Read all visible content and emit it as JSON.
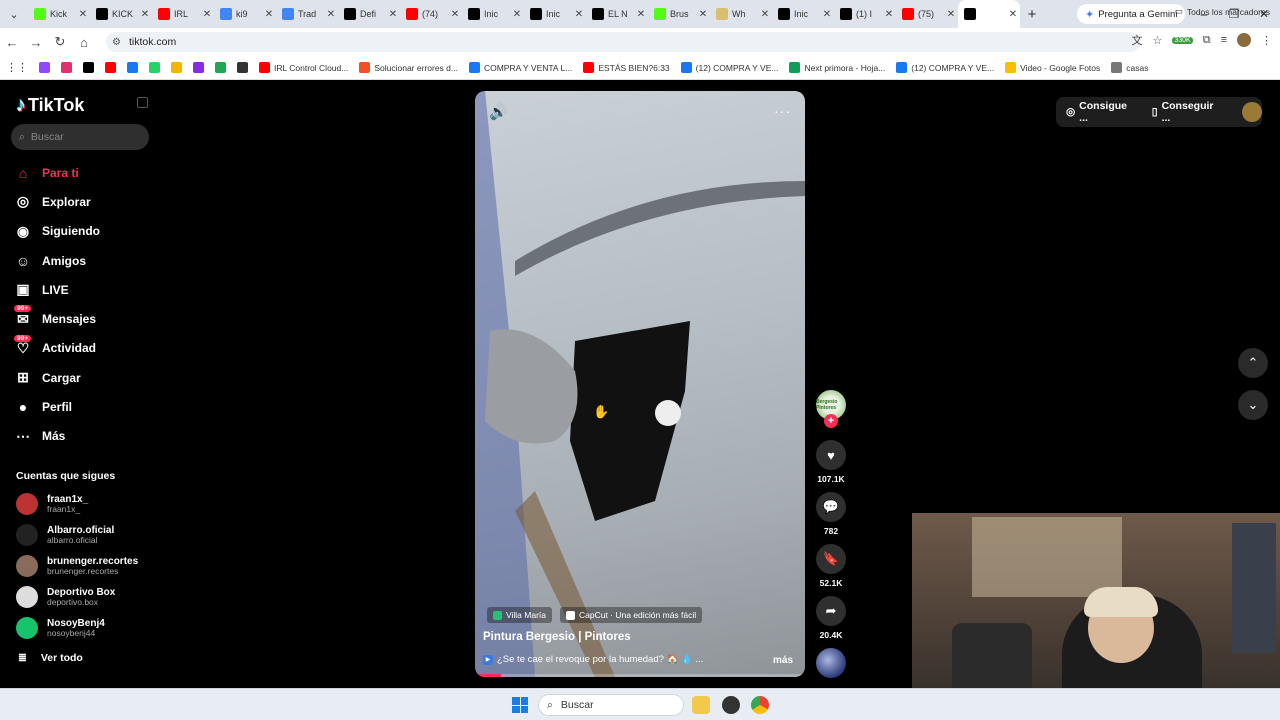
{
  "browser": {
    "tabs": [
      {
        "title": "Kick",
        "icon": "kick-icon",
        "color": "#53fc18"
      },
      {
        "title": "KICK",
        "icon": "x-icon",
        "color": "#000000"
      },
      {
        "title": "IRL",
        "icon": "youtube-icon",
        "color": "#ff0000"
      },
      {
        "title": "ki9",
        "icon": "google-icon",
        "color": "#4285f4"
      },
      {
        "title": "Trad",
        "icon": "translate-icon",
        "color": "#4285f4"
      },
      {
        "title": "Defi",
        "icon": "x-icon",
        "color": "#000000"
      },
      {
        "title": "(74)",
        "icon": "youtube-icon",
        "color": "#ff0000"
      },
      {
        "title": "Inic",
        "icon": "x-icon",
        "color": "#000000"
      },
      {
        "title": "Inic",
        "icon": "x-icon",
        "color": "#000000"
      },
      {
        "title": "EL N",
        "icon": "tiktok-icon",
        "color": "#000000"
      },
      {
        "title": "Brus",
        "icon": "kick-icon",
        "color": "#53fc18"
      },
      {
        "title": "Wh",
        "icon": "whatsapp-icon",
        "color": "#d8c070"
      },
      {
        "title": "Inic",
        "icon": "x-icon",
        "color": "#000000"
      },
      {
        "title": "(1) I",
        "icon": "x-icon",
        "color": "#000000"
      },
      {
        "title": "(75)",
        "icon": "youtube-icon",
        "color": "#ff0000"
      },
      {
        "title": "",
        "icon": "tiktok-icon",
        "color": "#000000",
        "active": true
      }
    ],
    "gemini_label": "Pregunta a Gemini",
    "url": "tiktok.com",
    "extension_badge": "330K",
    "bookmarks": [
      {
        "label": "",
        "color": "#9146ff"
      },
      {
        "label": "",
        "color": "#e1306c"
      },
      {
        "label": "",
        "color": "#000000"
      },
      {
        "label": "",
        "color": "#ff0000"
      },
      {
        "label": "",
        "color": "#1877f2"
      },
      {
        "label": "",
        "color": "#25d366"
      },
      {
        "label": "",
        "color": "#f4b400"
      },
      {
        "label": "",
        "color": "#8a2be2"
      },
      {
        "label": "",
        "color": "#1da851"
      },
      {
        "label": "",
        "color": "#333333"
      },
      {
        "label": "IRL Control Cloud...",
        "color": "#ff0000"
      },
      {
        "label": "Solucionar errores d...",
        "color": "#f25022"
      },
      {
        "label": "COMPRA Y VENTA L...",
        "color": "#1877f2"
      },
      {
        "label": "ESTÁS BIEN?6:33",
        "color": "#ff0000"
      },
      {
        "label": "(12) COMPRA Y VE...",
        "color": "#1877f2"
      },
      {
        "label": "Next primora - Hoja...",
        "color": "#0f9d58"
      },
      {
        "label": "(12) COMPRA Y VE...",
        "color": "#1877f2"
      },
      {
        "label": "Video - Google Fotos",
        "color": "#fbbc05"
      },
      {
        "label": "casas",
        "color": "#777777"
      }
    ],
    "all_bookmarks_label": "Todos los marcadores"
  },
  "sidebar": {
    "brand": "TikTok",
    "search_placeholder": "Buscar",
    "nav": [
      {
        "label": "Para ti",
        "icon": "home-icon",
        "active": true
      },
      {
        "label": "Explorar",
        "icon": "compass-icon"
      },
      {
        "label": "Siguiendo",
        "icon": "following-icon"
      },
      {
        "label": "Amigos",
        "icon": "friends-icon"
      },
      {
        "label": "LIVE",
        "icon": "live-icon"
      },
      {
        "label": "Mensajes",
        "icon": "messages-icon",
        "badge": "99+"
      },
      {
        "label": "Actividad",
        "icon": "activity-icon",
        "badge": "99+"
      },
      {
        "label": "Cargar",
        "icon": "upload-icon"
      },
      {
        "label": "Perfil",
        "icon": "profile-icon"
      },
      {
        "label": "Más",
        "icon": "more-icon"
      }
    ],
    "following_title": "Cuentas que sigues",
    "accounts": [
      {
        "name": "fraan1x_",
        "handle": "fraan1x_",
        "color": "#b33"
      },
      {
        "name": "Albarro.oficial",
        "handle": "albarro.oficial",
        "color": "#222"
      },
      {
        "name": "brunenger.recortes",
        "handle": "brunenger.recortes",
        "color": "#8a6a5a"
      },
      {
        "name": "Deportivo Box",
        "handle": "deportivo.box",
        "color": "#ddd"
      },
      {
        "name": "NosoyBenj4",
        "handle": "nosoybenj44",
        "color": "#17c46b"
      }
    ],
    "see_all": "Ver todo"
  },
  "video": {
    "tags": [
      "Villa María",
      "CapCut · Una edición más fácil"
    ],
    "author": "Pintura Bergesio | Pintores",
    "description": "¿Se te cae el revoque por la humedad? 🏠 💧 ...",
    "more_label": "más",
    "progress": 0.08
  },
  "actions": {
    "avatar_text": "Bergesio Pintores",
    "likes": "107.1K",
    "comments": "782",
    "saves": "52.1K",
    "shares": "20.4K"
  },
  "topright": {
    "coins_label": "Consigue ...",
    "app_label": "Conseguir ..."
  },
  "taskbar": {
    "search_placeholder": "Buscar"
  }
}
